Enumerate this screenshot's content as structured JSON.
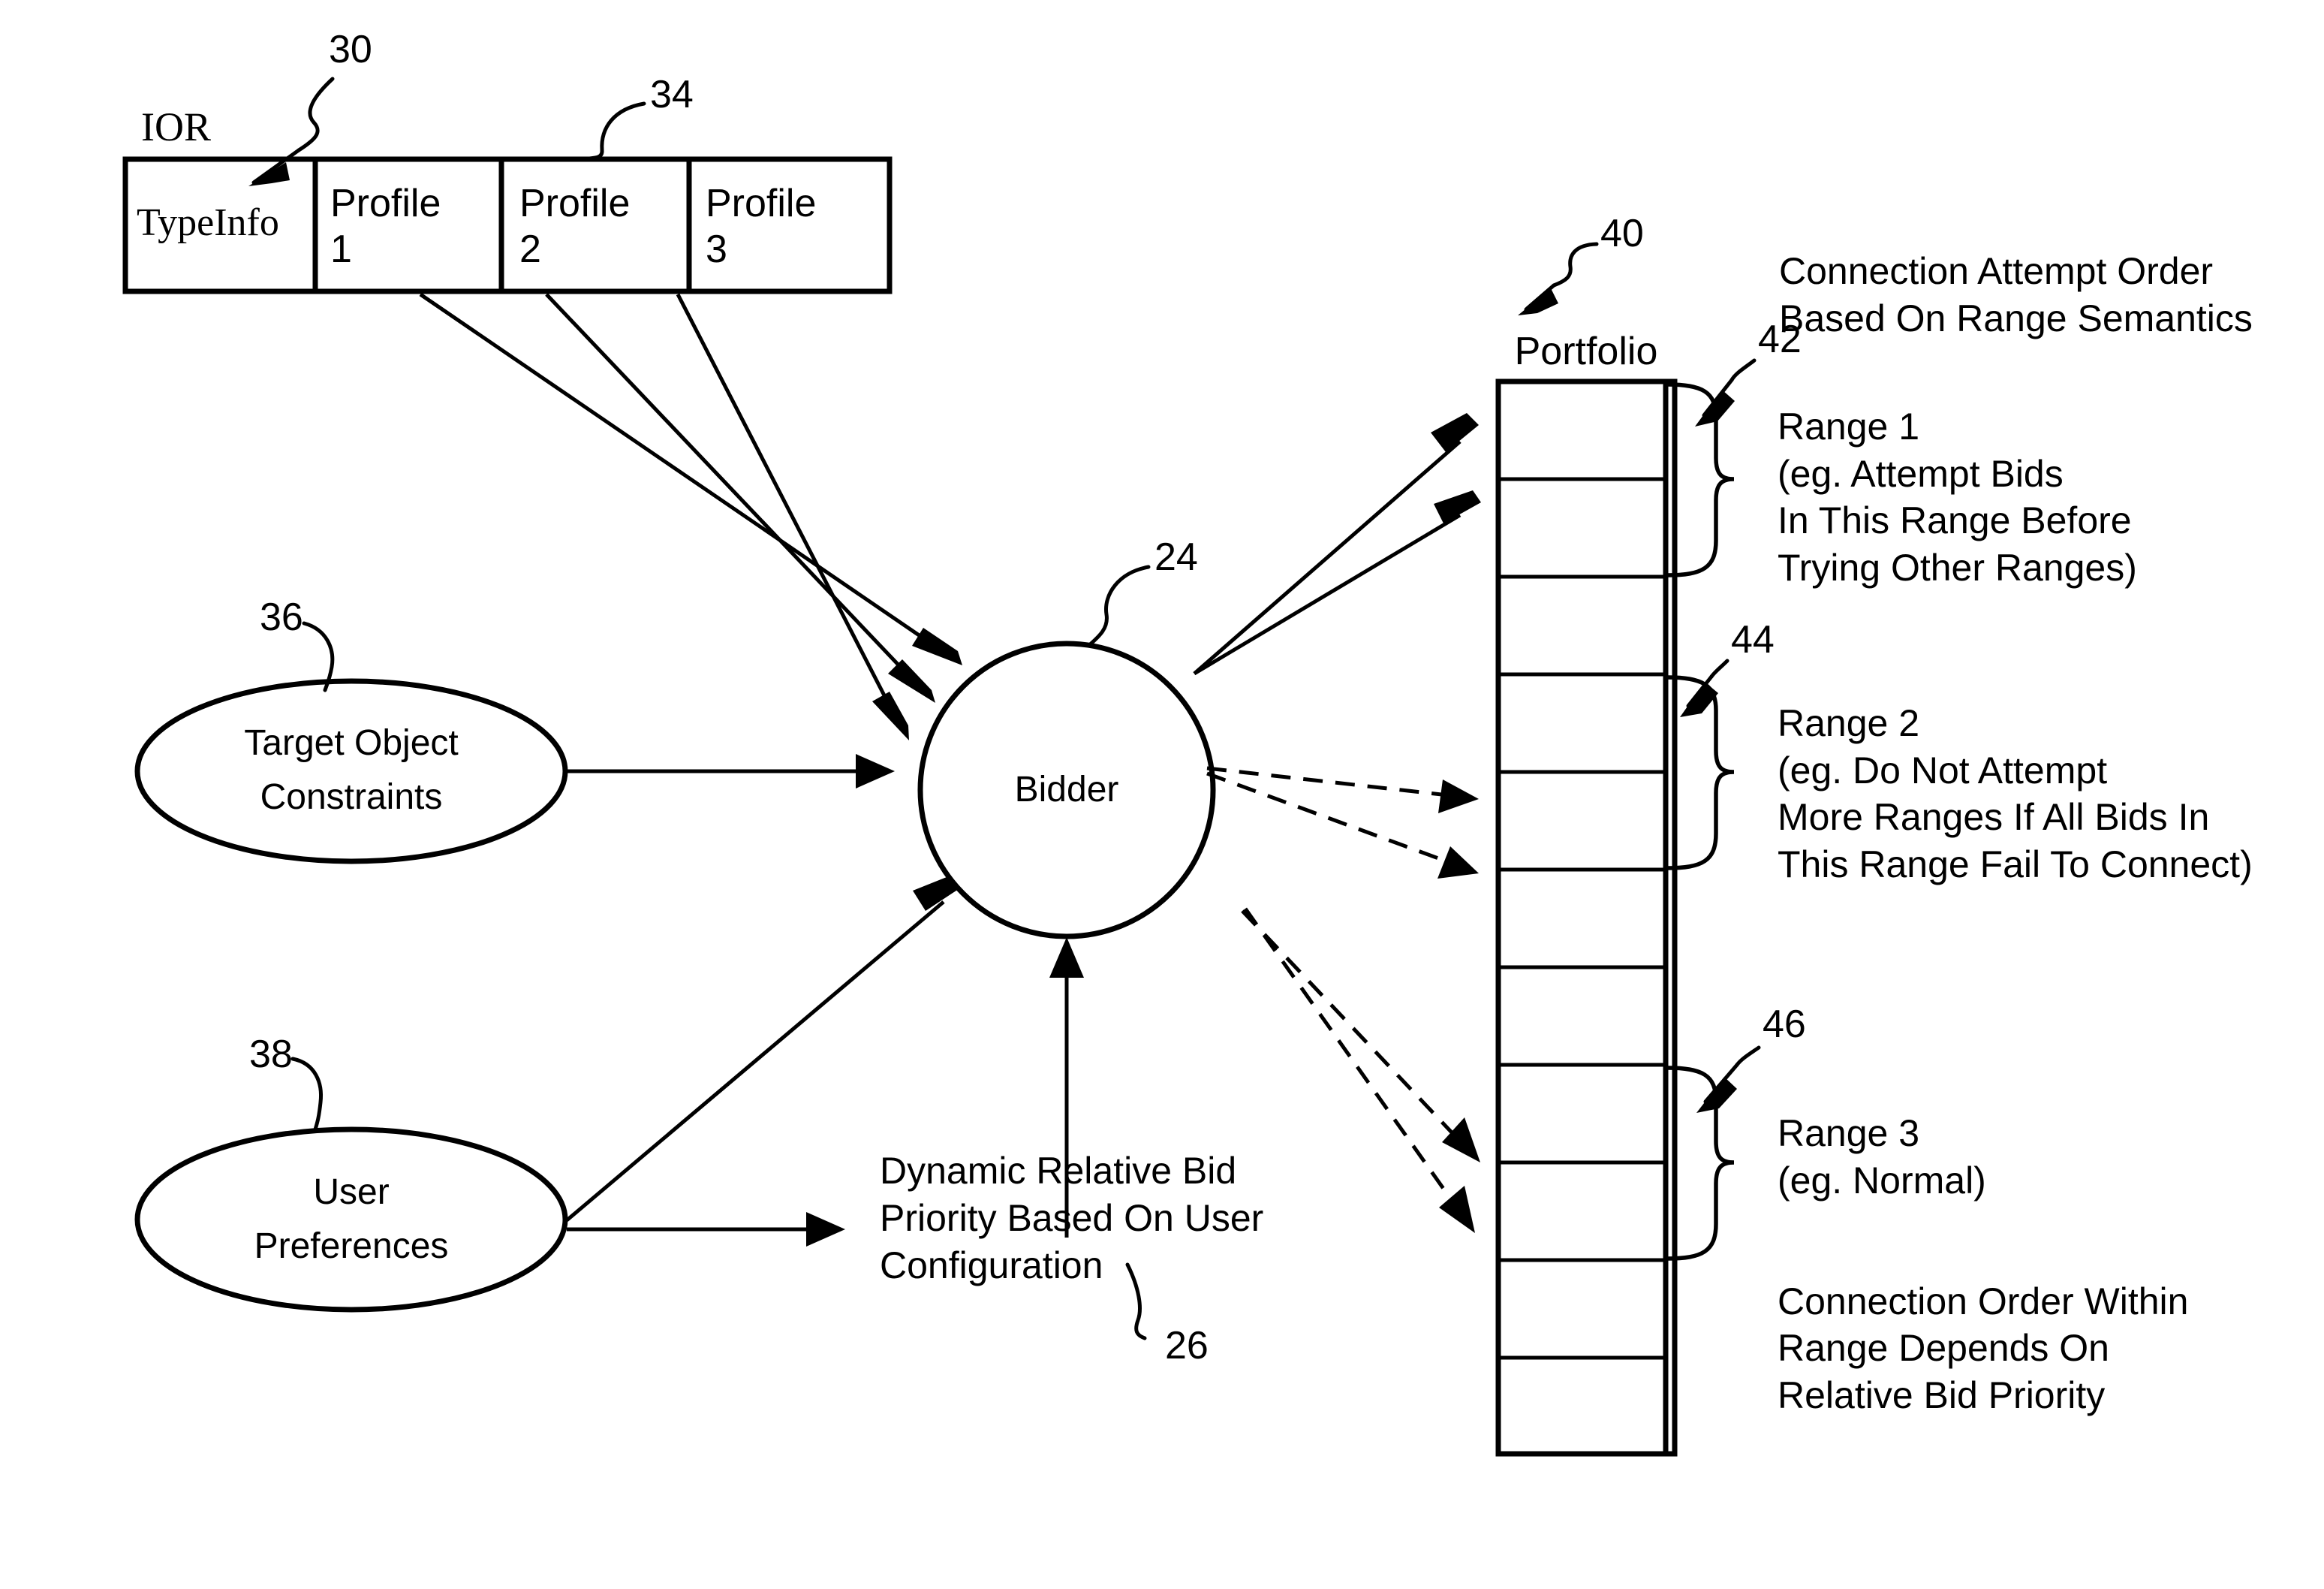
{
  "figure": {
    "ior": {
      "label": "IOR",
      "ref": "30",
      "profile_group_ref": "34",
      "cells": [
        {
          "line1": "TypeInfo",
          "line2": ""
        },
        {
          "line1": "Profile",
          "line2": "1"
        },
        {
          "line1": "Profile",
          "line2": "2"
        },
        {
          "line1": "Profile",
          "line2": "3"
        }
      ]
    },
    "bidder": {
      "label": "Bidder",
      "ref": "24"
    },
    "inputs": [
      {
        "line1": "Target Object",
        "line2": "Constraints",
        "ref": "36"
      },
      {
        "line1": "User",
        "line2": "Preferences",
        "ref": "38"
      }
    ],
    "bid_priority_note": {
      "lines": [
        "Dynamic Relative Bid",
        "Priority Based On User",
        "Configuration"
      ],
      "ref": "26"
    },
    "portfolio": {
      "label": "Portfolio",
      "ref": "40",
      "row_count": 11,
      "heading": [
        "Connection Attempt Order",
        "Based On Range Semantics"
      ],
      "footer": [
        "Connection Order Within",
        "Range Depends On",
        "Relative Bid Priority"
      ],
      "ranges": [
        {
          "ref": "42",
          "title": "Range 1",
          "detail": [
            "(eg. Attempt Bids",
            "In This Range Before",
            "Trying Other Ranges)"
          ]
        },
        {
          "ref": "44",
          "title": "Range 2",
          "detail": [
            "(eg. Do Not Attempt",
            "More Ranges If All Bids In",
            "This Range Fail To Connect)"
          ]
        },
        {
          "ref": "46",
          "title": "Range 3",
          "detail": [
            "(eg. Normal)"
          ]
        }
      ]
    },
    "colors": {
      "ink": "#000000",
      "paper": "#ffffff"
    }
  }
}
